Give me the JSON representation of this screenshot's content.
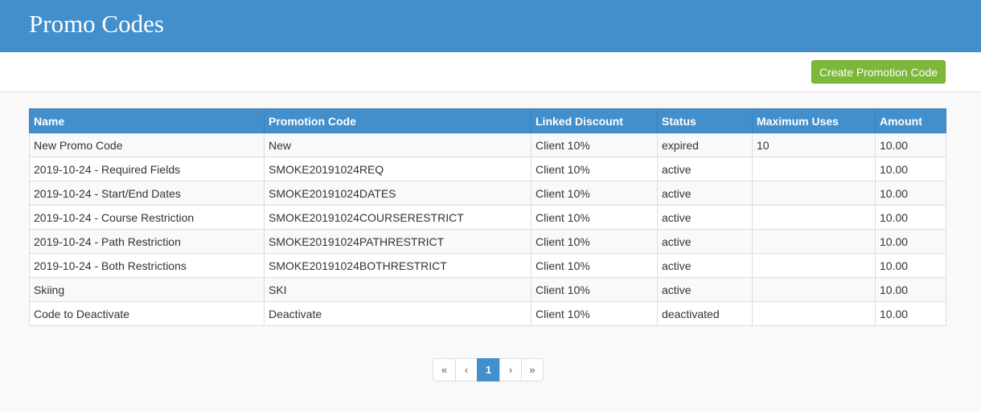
{
  "header": {
    "title": "Promo Codes"
  },
  "toolbar": {
    "create_label": "Create Promotion Code"
  },
  "table": {
    "columns": [
      "Name",
      "Promotion Code",
      "Linked Discount",
      "Status",
      "Maximum Uses",
      "Amount"
    ],
    "rows": [
      [
        "New Promo Code",
        "New",
        "Client 10%",
        "expired",
        "10",
        "10.00"
      ],
      [
        "2019-10-24 - Required Fields",
        "SMOKE20191024REQ",
        "Client 10%",
        "active",
        "",
        "10.00"
      ],
      [
        "2019-10-24 - Start/End Dates",
        "SMOKE20191024DATES",
        "Client 10%",
        "active",
        "",
        "10.00"
      ],
      [
        "2019-10-24 - Course Restriction",
        "SMOKE20191024COURSERESTRICT",
        "Client 10%",
        "active",
        "",
        "10.00"
      ],
      [
        "2019-10-24 - Path Restriction",
        "SMOKE20191024PATHRESTRICT",
        "Client 10%",
        "active",
        "",
        "10.00"
      ],
      [
        "2019-10-24 - Both Restrictions",
        "SMOKE20191024BOTHRESTRICT",
        "Client 10%",
        "active",
        "",
        "10.00"
      ],
      [
        "Skiing",
        "SKI",
        "Client 10%",
        "active",
        "",
        "10.00"
      ],
      [
        "Code to Deactivate",
        "Deactivate",
        "Client 10%",
        "deactivated",
        "",
        "10.00"
      ]
    ]
  },
  "pagination": {
    "first": "«",
    "prev": "‹",
    "current": "1",
    "next": "›",
    "last": "»"
  },
  "colors": {
    "header_bg": "#428fcc",
    "create_button": "#7cb83a",
    "active_page": "#428fcc"
  }
}
